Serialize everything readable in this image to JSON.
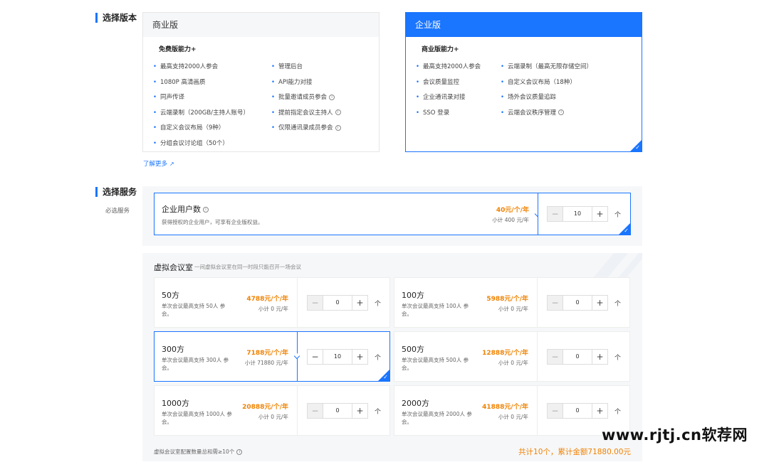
{
  "version_section": {
    "title": "选择版本",
    "business": {
      "name": "商业版",
      "subtitle": "免费版能力+",
      "features_left": [
        "最高支持2000人参会",
        "1080P 高清画质",
        "同声传译",
        "云端录制（200GB/主持人账号）",
        "自定义会议布局（9种）",
        "分组会议讨论组（50个）"
      ],
      "features_right": [
        "管理后台",
        "API能力对接",
        "批量邀请成员参会",
        "提前指定会议主持人",
        "仅限通讯录成员参会"
      ]
    },
    "enterprise": {
      "name": "企业版",
      "subtitle": "商业版能力+",
      "features_left": [
        "最高支持2000人参会",
        "会议质量监控",
        "企业通讯录对接",
        "SSO 登录"
      ],
      "features_right": [
        "云端录制（最高无限存储空间）",
        "自定义会议布局（18种）",
        "场外会议质量追踪",
        "云端会议秩序管理"
      ]
    },
    "learn_more": "了解更多",
    "accent": "#1a75ff"
  },
  "service_section": {
    "title": "选择服务",
    "required_label": "必选服务",
    "users": {
      "title": "企业用户数",
      "desc": "获得授权的企业用户，可享有企业版权益。",
      "price": "40元/个/年",
      "subtotal": "小计 400 元/年",
      "qty": "10",
      "unit": "个"
    }
  },
  "rooms_section": {
    "title": "虚拟会议室",
    "subtitle": "一间虚拟会议室在同一时段只能召开一场会议",
    "unit": "个",
    "rooms": [
      {
        "name": "50方",
        "desc": "单次会议最高支持 50人 参会。",
        "price": "4788元/个/年",
        "subtotal": "小计 0 元/年",
        "qty": "0"
      },
      {
        "name": "100方",
        "desc": "单次会议最高支持 100人 参会。",
        "price": "5988元/个/年",
        "subtotal": "小计 0 元/年",
        "qty": "0"
      },
      {
        "name": "300方",
        "desc": "单次会议最高支持 300人 参会。",
        "price": "7188元/个/年",
        "subtotal": "小计 71880 元/年",
        "qty": "10"
      },
      {
        "name": "500方",
        "desc": "单次会议最高支持 500人 参会。",
        "price": "12888元/个/年",
        "subtotal": "小计 0 元/年",
        "qty": "0"
      },
      {
        "name": "1000方",
        "desc": "单次会议最高支持 1000人 参会。",
        "price": "20888元/个/年",
        "subtotal": "小计 0 元/年",
        "qty": "0"
      },
      {
        "name": "2000方",
        "desc": "单次会议最高支持 2000人 参会。",
        "price": "41888元/个/年",
        "subtotal": "小计 0 元/年",
        "qty": "0"
      }
    ],
    "footer_note": "虚拟会议室配置数量总和需≥10个",
    "total": "共计10个，累计金额71880.00元"
  },
  "watermark": "www.rjtj.cn软荐网",
  "colors": {
    "price": "#f08200",
    "selected": "#1a75ff"
  }
}
